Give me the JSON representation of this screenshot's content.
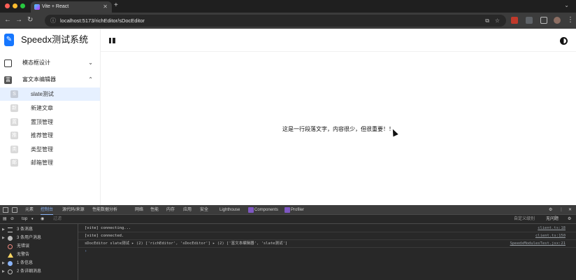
{
  "browser": {
    "tab_title": "Vite + React",
    "url": "localhost:5173/richEditor/sDocEditor",
    "new_tab": "+"
  },
  "app": {
    "brand": "Speedx测试系统",
    "content_text": "这是一行段落文字，内容很少，但很重要！！"
  },
  "sidebar": {
    "group1": {
      "label": "模态框设计",
      "icon_char": "",
      "chevron": "⌄"
    },
    "group2": {
      "label": "富文本编辑器",
      "icon_char": "富",
      "chevron": "⌃"
    },
    "items": [
      {
        "label": "slate测试",
        "icon_char": "S",
        "selected": true
      },
      {
        "label": "新建文章",
        "icon_char": "新"
      },
      {
        "label": "置顶管理",
        "icon_char": "置"
      },
      {
        "label": "推荐管理",
        "icon_char": "推"
      },
      {
        "label": "类型管理",
        "icon_char": "类"
      },
      {
        "label": "邮箱管理",
        "icon_char": "邮"
      }
    ]
  },
  "devtools": {
    "tabs": [
      "元素",
      "控制台",
      "源代码/来源",
      "性能数据分析",
      "网络",
      "性能",
      "内存",
      "应用",
      "安全",
      "Lighthouse",
      "Components",
      "Profiler"
    ],
    "context": "top",
    "filter_placeholder": "过滤",
    "level_select": "自定义级别",
    "issues": "无问题",
    "left_rows": [
      {
        "label": "3 条消息"
      },
      {
        "label": "3 条用户消息"
      },
      {
        "label": "无错误"
      },
      {
        "label": "无警告"
      },
      {
        "label": "1 条信息"
      },
      {
        "label": "2 条详细消息"
      }
    ],
    "logs": [
      {
        "msg": "[vite] connecting...",
        "src": "client.ts:18"
      },
      {
        "msg": "[vite] connected.",
        "src": "client.ts:150"
      },
      {
        "msg": "sDocEditor slate测试  ▸ (2) ['richEditor', 'sDocEditor']  ▸ (2) ['富文本编辑器', 'slate测试']",
        "src": "SpeedxModulesTest.jsx:21"
      }
    ],
    "prompt": "›"
  },
  "colors": {
    "accent": "#1677ff",
    "selected_bg": "#e6f0ff",
    "devtools_bg": "#282828"
  }
}
